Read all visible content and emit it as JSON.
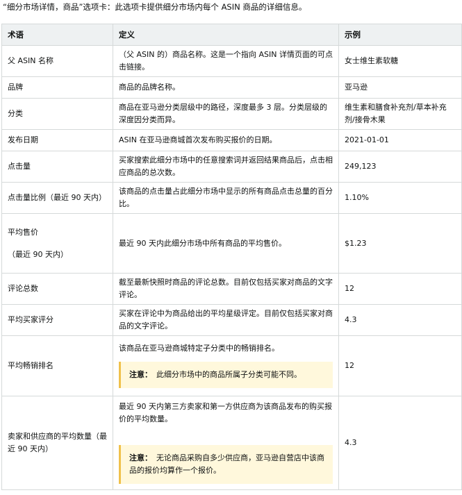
{
  "intro": "“细分市场详情，商品”选项卡：此选项卡提供细分市场内每个 ASIN 商品的详细信息。",
  "headers": {
    "term": "术语",
    "definition": "定义",
    "example": "示例"
  },
  "rows": [
    {
      "term": "父 ASIN 名称",
      "definition": "（父 ASIN 的）商品名称。这是一个指向 ASIN 详情页面的可点击链接。",
      "example": "女士维生素软糖"
    },
    {
      "term": "品牌",
      "definition": "商品的品牌名称。",
      "example": "亚马逊"
    },
    {
      "term": "分类",
      "definition": "商品在亚马逊分类层级中的路径，深度最多 3 层。分类层级的深度因分类而异。",
      "example": "维生素和膳食补充剂/草本补充剂/接骨木果"
    },
    {
      "term": "发布日期",
      "definition": "ASIN 在亚马逊商城首次发布购买报价的日期。",
      "example": "2021-01-01"
    },
    {
      "term": "点击量",
      "definition": "买家搜索此细分市场中的任意搜索词并返回结果商品后，点击相应商品的总次数。",
      "example": "249,123"
    },
    {
      "term": "点击量比例（最近 90 天内）",
      "definition": "该商品的点击量占此细分市场中显示的所有商品点击总量的百分比。",
      "example": "1.10%"
    },
    {
      "term": "平均售价",
      "term_sub": "（最近 90 天内）",
      "definition": "最近 90 天内此细分市场中所有商品的平均售价。",
      "example": "$1.23"
    },
    {
      "term": "评论总数",
      "definition": "截至最新快照时商品的评论总数。目前仅包括买家对商品的文字评论。",
      "example": "12"
    },
    {
      "term": "平均买家评分",
      "definition": "买家在评论中为商品给出的平均星级评定。目前仅包括买家对商品的文字评论。",
      "example": "4.3"
    },
    {
      "term": "平均畅销排名",
      "definition": "该商品在亚马逊商城特定子分类中的畅销排名。",
      "note_label": "注意：",
      "note": "此细分市场中的商品所属子分类可能不同。",
      "example": "12"
    },
    {
      "term": "卖家和供应商的平均数量（最近 90 天内）",
      "definition": "最近 90 天内第三方卖家和第一方供应商为该商品发布的购买报价的平均数量。",
      "note_label": "注意：",
      "note": "无论商品采购自多少供应商，亚马逊自营店中该商品的报价均算作一个报价。",
      "example": "4.3"
    }
  ]
}
